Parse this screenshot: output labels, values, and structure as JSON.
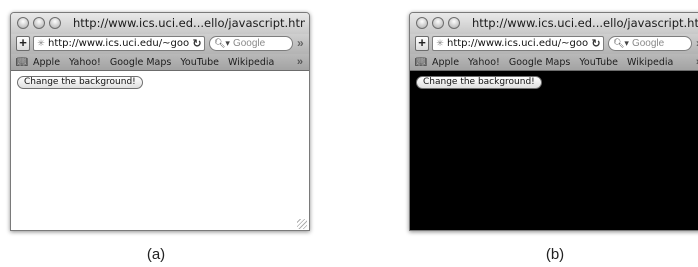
{
  "windows": [
    {
      "title": "http://www.ics.uci.ed...ello/javascript.html",
      "url": "http://www.ics.uci.edu/~goo",
      "search_placeholder": "Google",
      "bookmarks": [
        "Apple",
        "Yahoo!",
        "Google Maps",
        "YouTube",
        "Wikipedia"
      ],
      "button_label": "Change the background!",
      "background_color": "#ffffff",
      "caption": "(a)"
    },
    {
      "title": "http://www.ics.uci.ed...ello/javascript.html",
      "url": "http://www.ics.uci.edu/~goo",
      "search_placeholder": "Google",
      "bookmarks": [
        "Apple",
        "Yahoo!",
        "Google Maps",
        "YouTube",
        "Wikipedia"
      ],
      "button_label": "Change the background!",
      "background_color": "#000000",
      "caption": "(b)"
    }
  ],
  "icons": {
    "add": "plus-icon",
    "site": "globe-icon",
    "reload": "reload-icon",
    "search": "search-icon",
    "bookmarks": "book-icon",
    "overflow": "chevron-double-right-icon"
  }
}
